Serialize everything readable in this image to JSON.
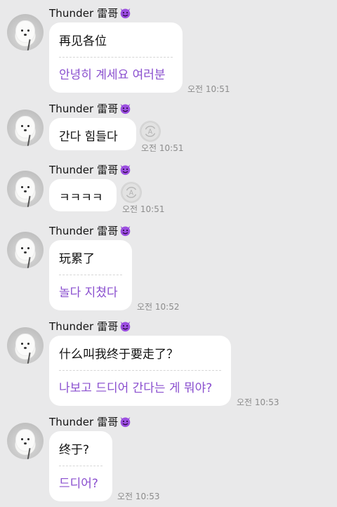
{
  "sender": {
    "name": "Thunder 雷哥"
  },
  "icons": {
    "avatar": "dog-avatar",
    "emoji": "smiling-devil-icon",
    "translate": "translate-icon"
  },
  "colors": {
    "background": "#e9e9ea",
    "bubble": "#ffffff",
    "translation": "#8a4fcf",
    "time": "#8c8c8c"
  },
  "messages": [
    {
      "original": "再见各位",
      "translation": "안녕히 계세요 여러분",
      "time": "오전 10:51"
    },
    {
      "original": "간다 힘들다",
      "time": "오전 10:51"
    },
    {
      "original": "ㅋㅋㅋㅋ",
      "time": "오전 10:51"
    },
    {
      "original": "玩累了",
      "translation": "놀다 지쳤다",
      "time": "오전 10:52"
    },
    {
      "original": "什么叫我终于要走了？",
      "translation": "나보고 드디어 간다는 게 뭐야?",
      "time": "오전 10:53"
    },
    {
      "original": "终于?",
      "translation": "드디어?",
      "time": "오전 10:53"
    }
  ]
}
